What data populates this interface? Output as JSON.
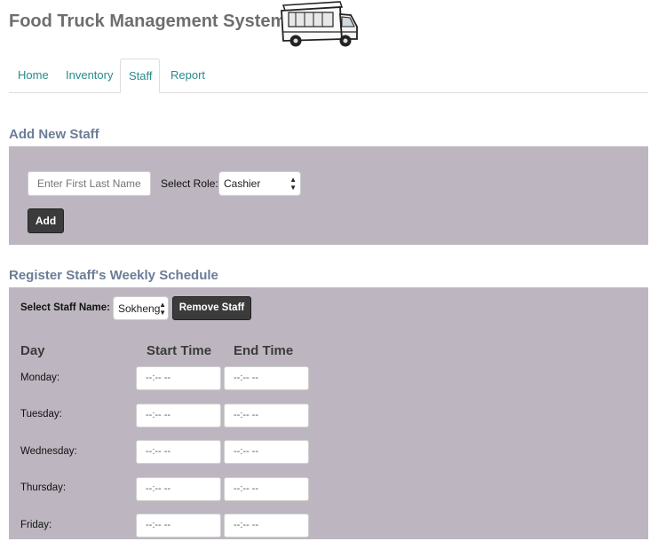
{
  "header": {
    "title": "Food Truck Management System",
    "logo_icon": "food-truck-icon"
  },
  "tabs": [
    {
      "label": "Home",
      "active": false
    },
    {
      "label": "Inventory",
      "active": false
    },
    {
      "label": "Staff",
      "active": true
    },
    {
      "label": "Report",
      "active": false
    }
  ],
  "add_staff": {
    "title": "Add New Staff",
    "name_placeholder": "Enter First Last Name",
    "role_label": "Select Role:",
    "role_value": "Cashier",
    "add_button": "Add"
  },
  "schedule": {
    "title": "Register Staff's Weekly Schedule",
    "staff_label": "Select Staff Name:",
    "staff_value": "Sokheng",
    "remove_button": "Remove Staff",
    "columns": {
      "day": "Day",
      "start": "Start Time",
      "end": "End Time"
    },
    "days": [
      "Monday:",
      "Tuesday:",
      "Wednesday:",
      "Thursday:",
      "Friday:"
    ],
    "time_placeholder": "--:-- --"
  },
  "colors": {
    "panel": "#bdb6c0",
    "tab_link": "#2a8a8a",
    "section_title": "#6b7d97",
    "button": "#3b3b3b"
  }
}
